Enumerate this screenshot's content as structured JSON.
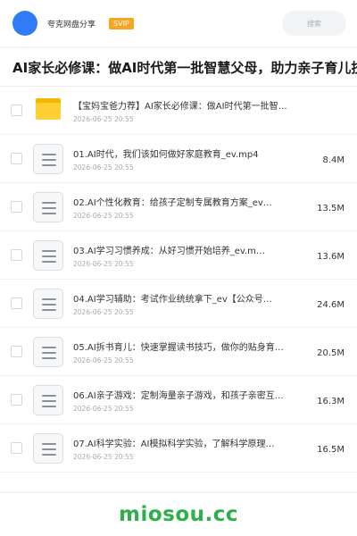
{
  "header": {
    "brand_name": "夸克网盘分享",
    "svip_badge": "SVIP",
    "search_label": "搜索"
  },
  "share_title": "AI家长必修课：做AI时代第一批智慧父母，助力亲子育儿技",
  "files": [
    {
      "icon": "folder-icon",
      "name": "【宝妈宝爸力荐】AI家长必修课：做AI时代第一批智…",
      "date": "2026-06-25 20:55",
      "size": ""
    },
    {
      "icon": "document-icon",
      "name": "01.AI时代，我们该如何做好家庭教育_ev.mp4",
      "date": "2026-06-25 20:55",
      "size": "8.4M"
    },
    {
      "icon": "document-icon",
      "name": "02.AI个性化教育：给孩子定制专属教育方案_ev…",
      "date": "2026-06-25 20:55",
      "size": "13.5M"
    },
    {
      "icon": "document-icon",
      "name": "03.AI学习习惯养成：从好习惯开始培养_ev.m…",
      "date": "2026-06-25 20:55",
      "size": "13.6M"
    },
    {
      "icon": "document-icon",
      "name": "04.AI学习辅助：考试作业统统拿下_ev【公众号…",
      "date": "2026-06-25 20:55",
      "size": "24.6M"
    },
    {
      "icon": "document-icon",
      "name": "05.AI拆书育儿：快速掌握读书技巧，做你的贴身育…",
      "date": "2026-06-25 20:55",
      "size": "20.5M"
    },
    {
      "icon": "document-icon",
      "name": "06.AI亲子游戏：定制海量亲子游戏，和孩子亲密互…",
      "date": "2026-06-25 20:55",
      "size": "16.3M"
    },
    {
      "icon": "document-icon",
      "name": "07.AI科学实验：AI模拟科学实验，了解科学原理…",
      "date": "2026-06-25 20:55",
      "size": "16.5M"
    }
  ],
  "watermark": "miosou.cc",
  "colors": {
    "accent_blue": "#2f7cf6",
    "svip_orange": "#f5a623",
    "folder_yellow": "#ffcf33",
    "watermark_green": "#2bb04a"
  }
}
